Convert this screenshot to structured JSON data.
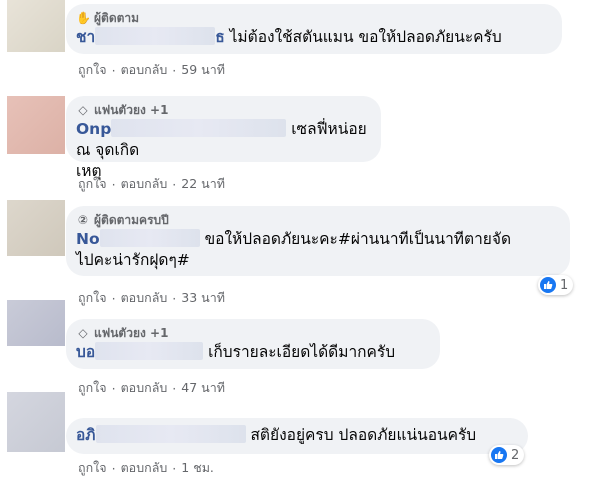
{
  "comments": [
    {
      "badge": "ผู้ติดตาม",
      "name_prefix": "ชา",
      "name_suffix": "ธ",
      "text": "ไม่ต้องใช้สตันแมน ขอให้ปลอดภัยนะครับ",
      "like_label": "ถูกใจ",
      "reply_label": "ตอบกลับ",
      "time": "59 นาที"
    },
    {
      "badge": "แฟนตัวยง +1",
      "name_prefix": "Onp",
      "text_line1": "เซลฟี่หน่อย ณ จุดเกิด",
      "text_line2": "เหตุ",
      "like_label": "ถูกใจ",
      "reply_label": "ตอบกลับ",
      "time": "22 นาที"
    },
    {
      "badge": "ผู้ติดตามครบปี",
      "name_prefix": "No",
      "text_line1": "ขอให้ปลอดภัยนะคะ#ผ่านนาทีเป็นนาทีตายจัด",
      "text_line2": "ไปคะน่ารักฝุดๆ#",
      "like_label": "ถูกใจ",
      "reply_label": "ตอบกลับ",
      "time": "33 นาที",
      "reaction_count": "1"
    },
    {
      "badge": "แฟนตัวยง +1",
      "name_prefix": "บอ",
      "text": "เก็บรายละเอียดได้ดีมากครับ",
      "like_label": "ถูกใจ",
      "reply_label": "ตอบกลับ",
      "time": "47 นาที"
    },
    {
      "name_prefix": "อภิ",
      "text": "สติยังอยู่ครบ ปลอดภัยแน่นอนครับ",
      "like_label": "ถูกใจ",
      "reply_label": "ตอบกลับ",
      "time": "1 ชม.",
      "reaction_count": "2"
    }
  ],
  "separator": "·",
  "colors": {
    "bubble": "#f0f2f5",
    "name": "#385898",
    "meta": "#65676b",
    "like": "#1877f2"
  }
}
